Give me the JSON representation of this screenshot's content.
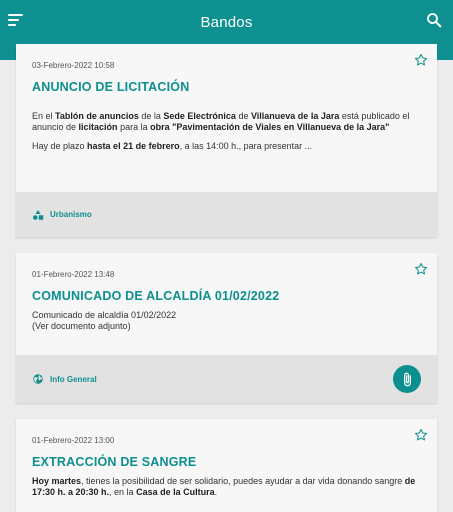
{
  "appbar": {
    "title": "Bandos"
  },
  "cards": [
    {
      "date": "03-Febrero-2022 10:58",
      "title": "ANUNCIO DE LICITACIÓN",
      "category": "Urbanismo",
      "p1": [
        {
          "t": "En el ",
          "b": false
        },
        {
          "t": "Tablón de anuncios",
          "b": true
        },
        {
          "t": " de la ",
          "b": false
        },
        {
          "t": "Sede Electrónica",
          "b": true
        },
        {
          "t": " de ",
          "b": false
        },
        {
          "t": "Villanueva de la Jara",
          "b": true
        },
        {
          "t": " está publicado el anuncio de ",
          "b": false
        },
        {
          "t": "licitación",
          "b": true
        },
        {
          "t": " para la ",
          "b": false
        },
        {
          "t": "obra",
          "b": true
        },
        {
          "t": " ",
          "b": false
        },
        {
          "t": "\"Pavimentación de Viales en Villanueva de la Jara\"",
          "b": true
        }
      ],
      "p2": [
        {
          "t": "Hay de plazo ",
          "b": false
        },
        {
          "t": "hasta el 21 de febrero",
          "b": true
        },
        {
          "t": ", a las 14:00 h., para presentar ...",
          "b": false
        }
      ]
    },
    {
      "date": "01-Febrero-2022 13:48",
      "title": "COMUNICADO DE ALCALDÍA 01/02/2022",
      "category": "Info General",
      "line1": "Comunicado de alcaldía 01/02/2022",
      "line2": "(Ver documento adjunto)"
    },
    {
      "date": "01-Febrero-2022 13:00",
      "title": "EXTRACCIÓN DE SANGRE",
      "p1": [
        {
          "t": "Hoy martes",
          "b": true
        },
        {
          "t": ",  tienes la posibilidad de ser solidario, puedes ayudar a dar vida donando sangre ",
          "b": false
        },
        {
          "t": "de 17:30 h. a 20:30 h.",
          "b": true
        },
        {
          "t": ", en la ",
          "b": false
        },
        {
          "t": "Casa de la Cultura",
          "b": true
        },
        {
          "t": ".",
          "b": false
        }
      ]
    }
  ],
  "icons": {
    "menu": "menu-icon",
    "search": "search-icon",
    "star": "star-outline-icon",
    "category1": "shapes-icon",
    "category2": "globe-icon",
    "attachment": "paperclip-icon"
  },
  "colors": {
    "primary": "#0e9090",
    "background": "#ececec",
    "card": "#f7f7f7",
    "footer": "#e2e2e2"
  }
}
